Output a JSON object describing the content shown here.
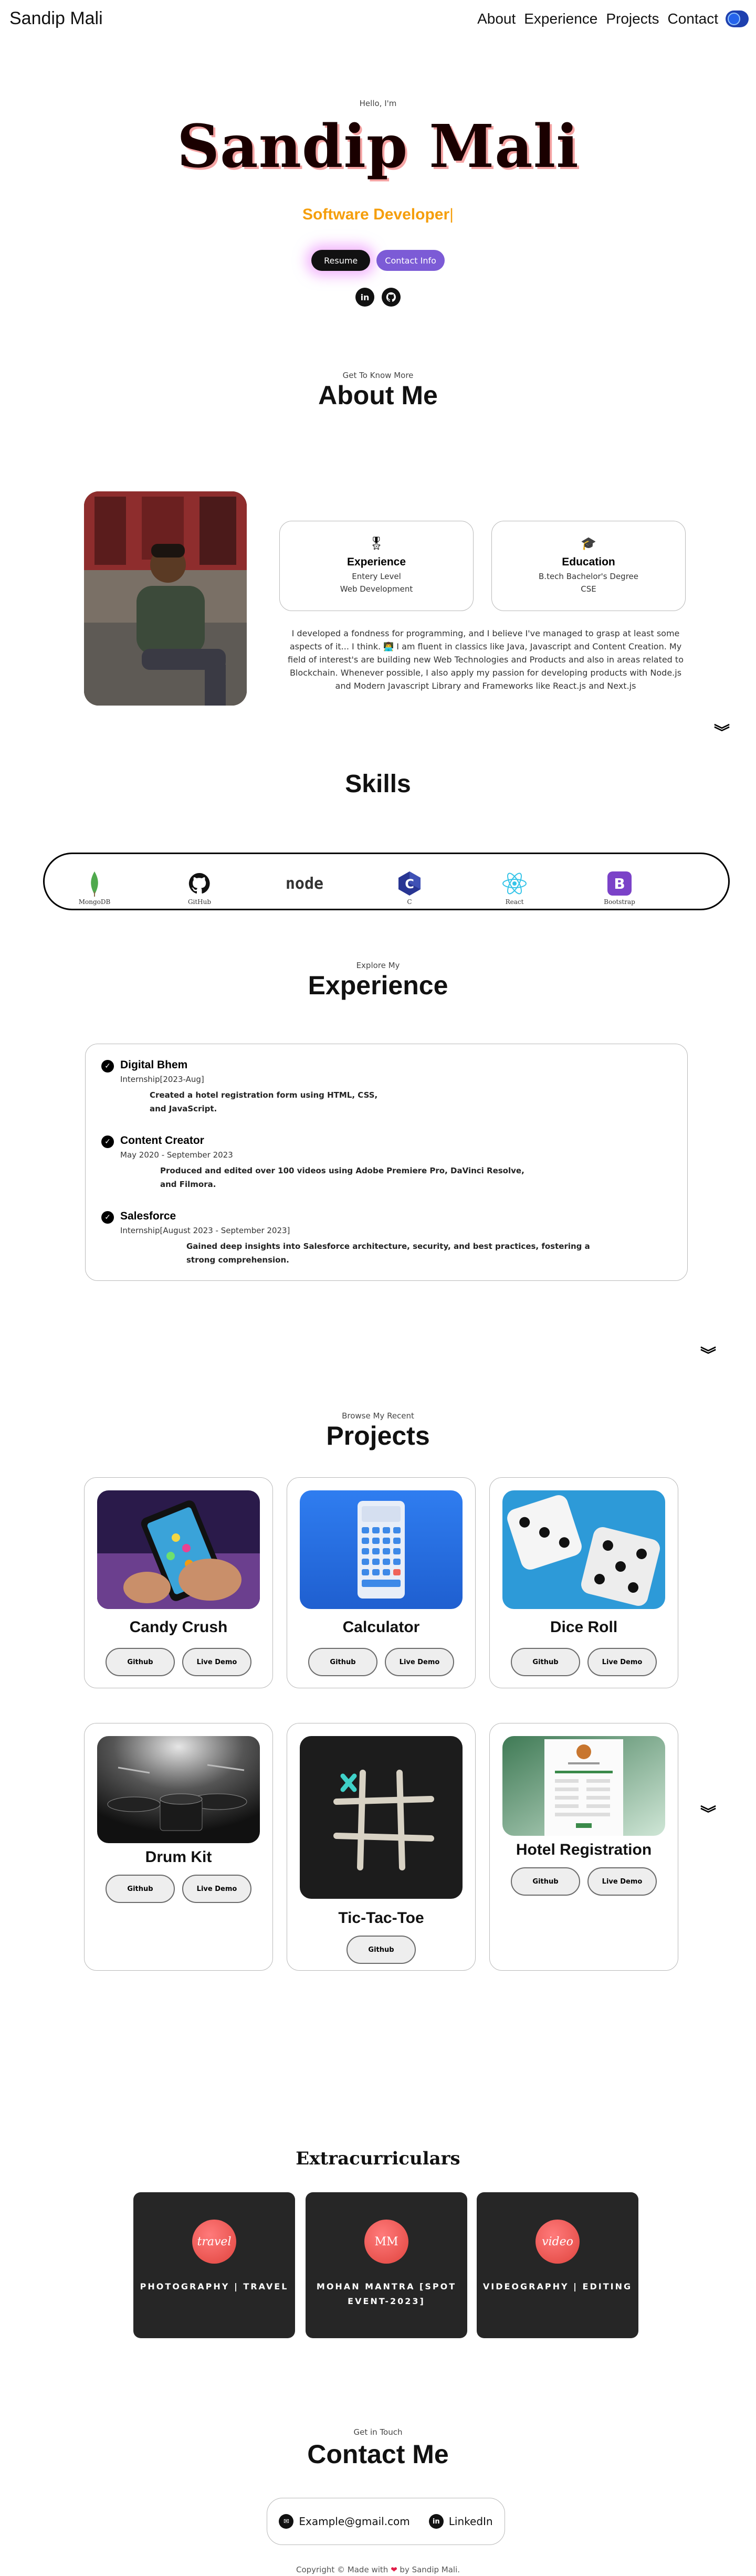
{
  "nav": {
    "logo": "Sandip Mali",
    "links": [
      "About",
      "Experience",
      "Projects",
      "Contact"
    ]
  },
  "hero": {
    "hello": "Hello, I'm",
    "name": "Sandip Mali",
    "role": "Software Developer",
    "resume_btn": "Resume",
    "contact_btn": "Contact Info",
    "icons": [
      "linkedin-icon",
      "github-icon"
    ]
  },
  "about": {
    "subtitle": "Get To Know More",
    "title": "About Me",
    "experience": {
      "title": "Experience",
      "lines": [
        "Entery Level",
        "Web Development"
      ]
    },
    "education": {
      "title": "Education",
      "lines": [
        "B.tech Bachelor's Degree",
        "CSE"
      ]
    },
    "bio": "I developed a fondness for programming, and I believe I've managed to grasp at least some aspects of it... I think. 👨‍💻 I am fluent in classics like Java, Javascript and Content Creation. My field of interest's are building new Web Technologies and Products and also in areas related to Blockchain. Whenever possible, I also apply my passion for developing products with Node.js and Modern Javascript Library and Frameworks like React.js and Next.js"
  },
  "skills": {
    "title": "Skills",
    "items": [
      "MongoDB",
      "GitHub",
      "",
      "C",
      "React",
      "Bootstrap"
    ],
    "node_logo_text": "node"
  },
  "experience": {
    "subtitle": "Explore My",
    "title": "Experience",
    "items": [
      {
        "title": "Digital Bhem",
        "role": "Internship[2023-Aug]",
        "desc": "Created a hotel registration form using HTML, CSS, and JavaScript."
      },
      {
        "title": "Content Creator",
        "role": "May 2020 - September 2023",
        "desc": "Produced and edited over 100 videos using Adobe Premiere Pro, DaVinci Resolve, and Filmora."
      },
      {
        "title": "Salesforce",
        "role": "Internship[August 2023 - September 2023]",
        "desc": "Gained deep insights into Salesforce architecture, security, and best practices, fostering a strong comprehension."
      }
    ]
  },
  "projects": {
    "subtitle": "Browse My Recent",
    "title": "Projects",
    "github_label": "Github",
    "demo_label": "Live Demo",
    "items": [
      {
        "name": "Candy Crush"
      },
      {
        "name": "Calculator"
      },
      {
        "name": "Dice Roll"
      },
      {
        "name": "Drum Kit"
      },
      {
        "name": "Tic-Tac-Toe"
      },
      {
        "name": "Hotel Registration"
      }
    ]
  },
  "extracurriculars": {
    "title": "Extracurriculars",
    "items": [
      {
        "circle": "travel",
        "label": "PHOTOGRAPHY | TRAVEL"
      },
      {
        "circle": "MM",
        "label": "MOHAN MANTRA [SPOT EVENT-2023]"
      },
      {
        "circle": "video",
        "label": "VIDEOGRAPHY | EDITING"
      }
    ]
  },
  "contact": {
    "subtitle": "Get in Touch",
    "title": "Contact Me",
    "email": "Example@gmail.com",
    "linkedin": "LinkedIn"
  },
  "footer": {
    "copyright_before": "Copyright © Made with",
    "copyright_after": "by Sandip Mali."
  },
  "colors": {
    "accent_orange": "#f59e0b",
    "button_purple": "#7c5bd6",
    "toggle_blue": "#1e40af",
    "extra_card_bg": "#262626"
  }
}
